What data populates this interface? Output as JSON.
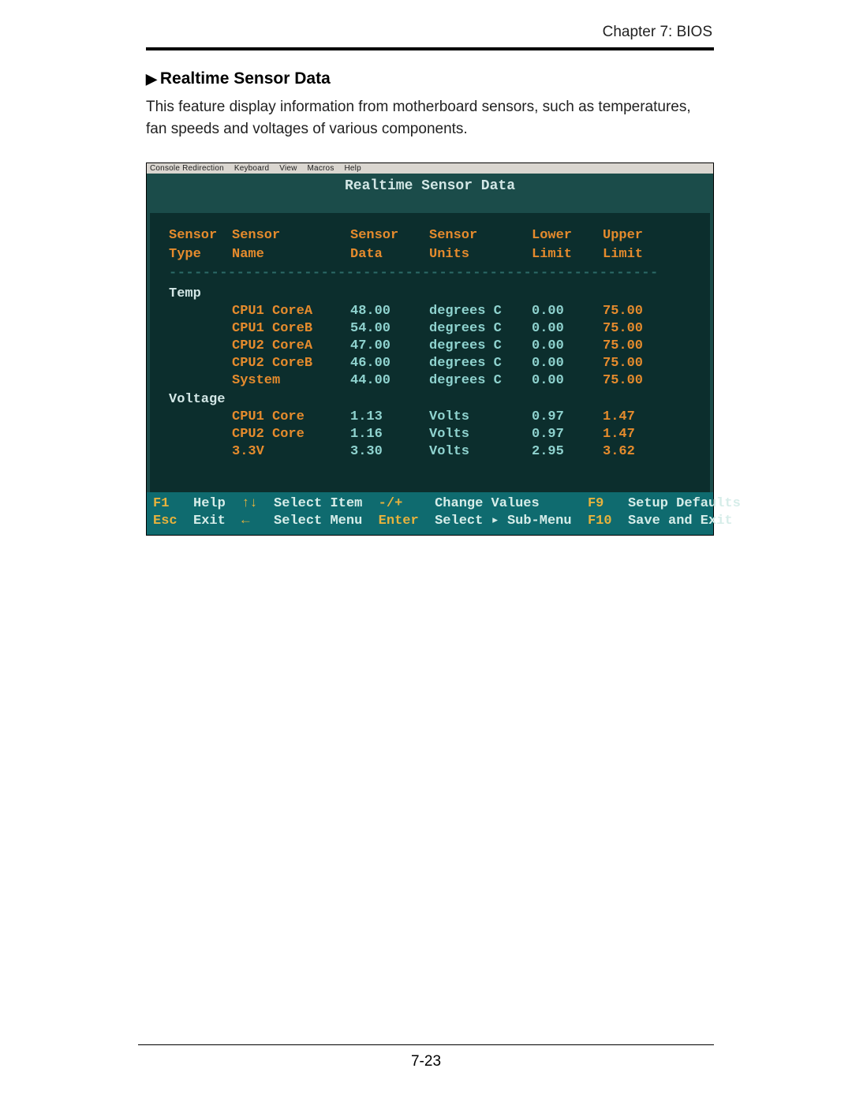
{
  "header": {
    "chapter": "Chapter 7: BIOS"
  },
  "section": {
    "marker": "▶",
    "title": "Realtime Sensor Data",
    "description": "This feature display information from motherboard sensors, such as temperatures, fan speeds and voltages of various components."
  },
  "console_menu": {
    "items": [
      "Console Redirection",
      "Keyboard",
      "View",
      "Macros",
      "Help"
    ]
  },
  "bios": {
    "title": "Realtime Sensor Data",
    "columns": {
      "c0a": "Sensor",
      "c0b": "Type",
      "c1a": "Sensor",
      "c1b": "Name",
      "c2a": "Sensor",
      "c2b": "Data",
      "c3a": "Sensor",
      "c3b": "Units",
      "c4a": "Lower",
      "c4b": "Limit",
      "c5a": "Upper",
      "c5b": "Limit"
    },
    "dash": "-----------------------------------------------------------------",
    "groups": [
      {
        "label": "Temp",
        "rows": [
          {
            "name": "CPU1 CoreA",
            "data": "48.00",
            "units": "degrees C",
            "lower": "0.00",
            "upper": "75.00"
          },
          {
            "name": "CPU1 CoreB",
            "data": "54.00",
            "units": "degrees C",
            "lower": "0.00",
            "upper": "75.00"
          },
          {
            "name": "CPU2 CoreA",
            "data": "47.00",
            "units": "degrees C",
            "lower": "0.00",
            "upper": "75.00"
          },
          {
            "name": "CPU2 CoreB",
            "data": "46.00",
            "units": "degrees C",
            "lower": "0.00",
            "upper": "75.00"
          },
          {
            "name": "System",
            "data": "44.00",
            "units": "degrees C",
            "lower": "0.00",
            "upper": "75.00"
          }
        ]
      },
      {
        "label": "Voltage",
        "rows": [
          {
            "name": "CPU1 Core",
            "data": "1.13",
            "units": "Volts",
            "lower": "0.97",
            "upper": "1.47"
          },
          {
            "name": "CPU2 Core",
            "data": "1.16",
            "units": "Volts",
            "lower": "0.97",
            "upper": "1.47"
          },
          {
            "name": "3.3V",
            "data": "3.30",
            "units": "Volts",
            "lower": "2.95",
            "upper": "3.62"
          }
        ]
      }
    ]
  },
  "footer": {
    "row1": [
      {
        "key": "F1",
        "label": "Help"
      },
      {
        "key": "↑↓",
        "label": "Select Item"
      },
      {
        "key": "-/+",
        "label": "Change Values"
      },
      {
        "key": "F9",
        "label": "Setup Defaults"
      }
    ],
    "row2": [
      {
        "key": "Esc",
        "label": "Exit"
      },
      {
        "key": "←",
        "label": "Select Menu"
      },
      {
        "key": "Enter",
        "label": "Select ▸ Sub-Menu"
      },
      {
        "key": "F10",
        "label": "Save and Exit"
      }
    ]
  },
  "page_number": "7-23"
}
